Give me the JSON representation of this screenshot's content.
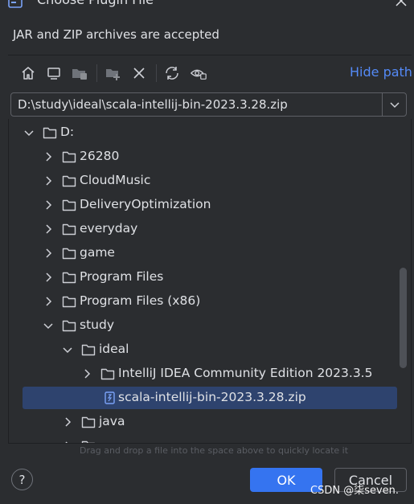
{
  "window": {
    "title": "Choose Plugin File"
  },
  "description": "JAR and ZIP archives are accepted",
  "toolbar": {
    "buttons": [
      {
        "name": "home-icon"
      },
      {
        "name": "desktop-icon"
      },
      {
        "name": "project-folder-icon"
      },
      {
        "name": "new-folder-icon"
      },
      {
        "name": "delete-icon"
      },
      {
        "name": "refresh-icon"
      },
      {
        "name": "show-hidden-icon"
      }
    ],
    "hide_path_label": "Hide path"
  },
  "path": {
    "value": "D:\\study\\ideal\\scala-intellij-bin-2023.3.28.zip"
  },
  "tree": {
    "rows": [
      {
        "label": "D:",
        "icon": "folder-icon",
        "depth": 0,
        "expanded": true
      },
      {
        "label": "26280",
        "icon": "folder-icon",
        "depth": 1,
        "expanded": false
      },
      {
        "label": "CloudMusic",
        "icon": "folder-icon",
        "depth": 1,
        "expanded": false
      },
      {
        "label": "DeliveryOptimization",
        "icon": "folder-icon",
        "depth": 1,
        "expanded": false
      },
      {
        "label": "everyday",
        "icon": "folder-icon",
        "depth": 1,
        "expanded": false
      },
      {
        "label": "game",
        "icon": "folder-icon",
        "depth": 1,
        "expanded": false
      },
      {
        "label": "Program Files",
        "icon": "folder-icon",
        "depth": 1,
        "expanded": false
      },
      {
        "label": "Program Files (x86)",
        "icon": "folder-icon",
        "depth": 1,
        "expanded": false
      },
      {
        "label": "study",
        "icon": "folder-icon",
        "depth": 1,
        "expanded": true
      },
      {
        "label": "ideal",
        "icon": "folder-icon",
        "depth": 2,
        "expanded": true
      },
      {
        "label": "IntelliJ IDEA Community Edition 2023.3.5",
        "icon": "folder-icon",
        "depth": 3,
        "expanded": false
      },
      {
        "label": "scala-intellij-bin-2023.3.28.zip",
        "icon": "zip-file-icon",
        "depth": 3,
        "selected": true
      },
      {
        "label": "java",
        "icon": "folder-icon",
        "depth": 2,
        "expanded": false
      }
    ]
  },
  "hint": "Drag and drop a file into the space above to quickly locate it",
  "buttons": {
    "help": "?",
    "ok": "OK",
    "cancel": "Cancel"
  },
  "watermark": "CSDN @柒seven.",
  "colors": {
    "background": "#2b2d30",
    "accent": "#3574f0",
    "link": "#548af7",
    "selection": "#2e436e"
  }
}
